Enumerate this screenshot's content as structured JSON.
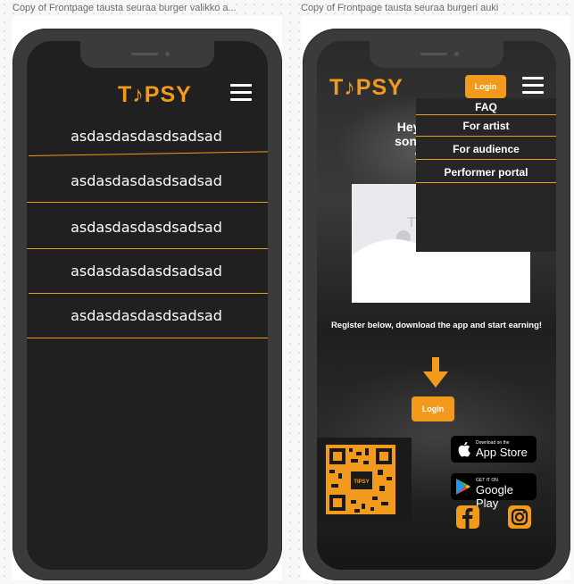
{
  "left_frame": {
    "label": "Copy of Frontpage tausta seuraa burger valikko a...",
    "logo": "T♪PSY",
    "menu_items": [
      "asdasdasdasdsadsad",
      "asdasdasdasdsadsad",
      "asdasdasdasdsadsad",
      "asdasdasdasdsadsad",
      "asdasdasdasdsadsad"
    ]
  },
  "right_frame": {
    "label": "Copy of Frontpage tausta seuraa burgeri auki",
    "logo": "T♪PSY",
    "login_label": "Login",
    "dropdown_items": [
      "FAQ",
      "For artist",
      "For audience",
      "Performer portal"
    ],
    "hero_lines": [
      "Hey Artist, do",
      "song requests",
      "your pe"
    ],
    "placeholder_letter": "T",
    "register_text": "Register below, download the app and start earning!",
    "login_button": "Login",
    "qr_logo": "TIPSY",
    "app_store": {
      "small": "Download on the",
      "big": "App Store"
    },
    "google_play": {
      "small": "GET IT ON",
      "big": "Google Play"
    },
    "social": [
      "facebook-icon",
      "instagram-icon"
    ]
  },
  "colors": {
    "accent": "#f29a1c",
    "screen_bg": "#202020",
    "phone_shell": "#3b3b3b",
    "text": "#ffffff"
  }
}
